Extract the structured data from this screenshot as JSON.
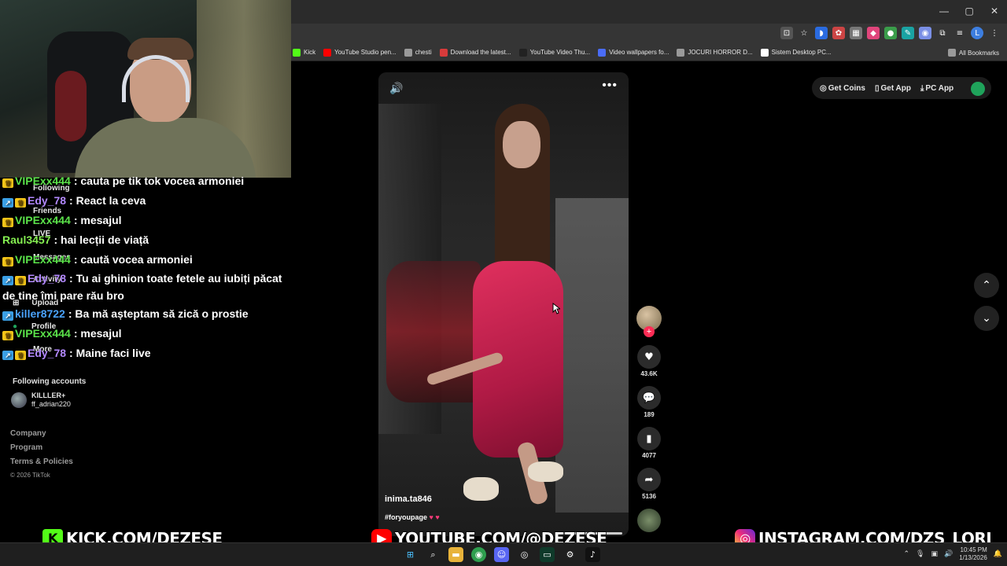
{
  "window_controls": {
    "minimize": "—",
    "maximize": "▢",
    "close": "✕"
  },
  "bookmarks": [
    {
      "label": "Kick",
      "color": "#53fc18"
    },
    {
      "label": "YouTube Studio pen...",
      "color": "#ff0000"
    },
    {
      "label": "chesti",
      "color": "#9a9a9a"
    },
    {
      "label": "Download the latest...",
      "color": "#d83b3b"
    },
    {
      "label": "YouTube Video Thu...",
      "color": "#222222"
    },
    {
      "label": "Video wallpapers fo...",
      "color": "#4a6cf7"
    },
    {
      "label": "JOCURI HORROR D...",
      "color": "#9a9a9a"
    },
    {
      "label": "Sistem Desktop PC...",
      "color": "#ffffff"
    }
  ],
  "all_bookmarks": "All Bookmarks",
  "sidebar": {
    "nav": [
      "Following",
      "Friends",
      "LIVE",
      "Messages",
      "Activity",
      "Upload",
      "Profile",
      "More"
    ],
    "following_title": "Following accounts",
    "account": {
      "name": "KILLLER+",
      "handle": "ff_adrian220"
    },
    "footer": [
      "Company",
      "Program",
      "Terms & Policies"
    ],
    "copyright": "© 2026 TikTok"
  },
  "chat": [
    {
      "badges": [
        "crown"
      ],
      "user": "VIPExx444",
      "color": "green",
      "text": ": cauta pe tik tok vocea armoniei"
    },
    {
      "badges": [
        "arrow",
        "crown"
      ],
      "user": "Edy_78",
      "color": "purple",
      "text": ": React la ceva"
    },
    {
      "badges": [
        "crown"
      ],
      "user": "VIPExx444",
      "color": "green",
      "text": ": mesajul"
    },
    {
      "badges": [],
      "user": "Raul3457",
      "color": "lime",
      "text": ": hai lecții de viață"
    },
    {
      "badges": [
        "crown"
      ],
      "user": "VIPExx444",
      "color": "green",
      "text": ": caută vocea armoniei"
    },
    {
      "badges": [
        "arrow",
        "crown"
      ],
      "user": "Edy_78",
      "color": "purple",
      "text": ": Tu ai ghinion toate fetele au iubiți păcat de tine îmi pare rău bro",
      "wrap": true
    },
    {
      "badges": [
        "arrow"
      ],
      "user": "killer8722",
      "color": "blue",
      "text": ": Ba mă așteptam să zică o prostie"
    },
    {
      "badges": [
        "crown"
      ],
      "user": "VIPExx444",
      "color": "green",
      "text": ": mesajul"
    },
    {
      "badges": [
        "arrow",
        "crown"
      ],
      "user": "Edy_78",
      "color": "purple",
      "text": ": Maine faci live"
    }
  ],
  "video": {
    "author": "inima.ta846",
    "tags": "#foryoupage",
    "hearts": "♥ ♥",
    "sound_icon": "🔊",
    "more_icon": "•••"
  },
  "actions": {
    "likes": "43.6K",
    "comments": "189",
    "saves": "4077",
    "shares": "5136"
  },
  "top_buttons": {
    "coins": "Get Coins",
    "app": "Get App",
    "pc_app": "PC App"
  },
  "banners": {
    "kick": "KICK.COM/DEZESE",
    "youtube": "YOUTUBE.COM/@DEZESE",
    "instagram": "INSTAGRAM.COM/DZS_LORI"
  },
  "clock": {
    "time": "10:45 PM",
    "date": "1/13/2026"
  },
  "colors": {
    "tiktok_red": "#fe2c55",
    "kick_green": "#53fc18",
    "youtube_red": "#ff0000"
  }
}
